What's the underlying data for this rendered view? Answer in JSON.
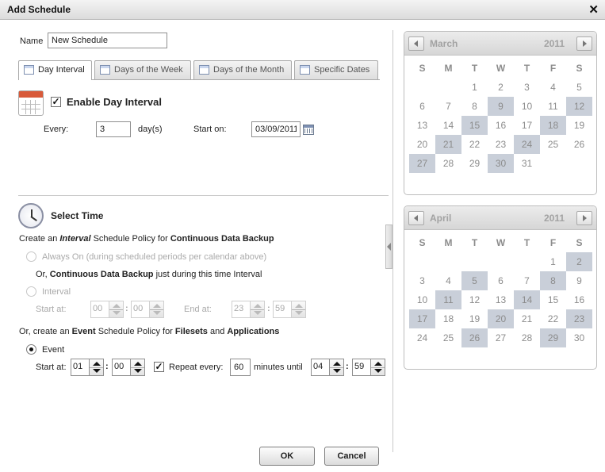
{
  "window": {
    "title": "Add Schedule",
    "close_icon": "✕"
  },
  "name_field": {
    "label": "Name",
    "value": "New Schedule"
  },
  "tabs": [
    {
      "label": "Day Interval",
      "active": true
    },
    {
      "label": "Days of the Week",
      "active": false
    },
    {
      "label": "Days of the Month",
      "active": false
    },
    {
      "label": "Specific Dates",
      "active": false
    }
  ],
  "day_interval": {
    "enable_label": "Enable Day Interval",
    "enabled": true,
    "every_label": "Every:",
    "every_value": "3",
    "unit_label": "day(s)",
    "start_on_label": "Start on:",
    "start_on_value": "03/09/2011"
  },
  "select_time": {
    "heading": "Select Time",
    "interval_policy": {
      "prefix": "Create an",
      "keyword": "Interval",
      "middle": "Schedule Policy for",
      "target": "Continuous Data Backup"
    },
    "always_on_label": "Always On (during scheduled periods per calendar above)",
    "or_cdb": {
      "prefix": "Or,",
      "target": "Continuous Data Backup",
      "suffix": "just during this time Interval"
    },
    "interval_label": "Interval",
    "start_at_label": "Start at:",
    "end_at_label": "End at:",
    "interval_start": {
      "hour": "00",
      "minute": "00"
    },
    "interval_end": {
      "hour": "23",
      "minute": "59"
    },
    "event_policy": {
      "prefix": "Or, create an",
      "keyword": "Event",
      "middle": "Schedule Policy for",
      "target1": "Filesets",
      "and": "and",
      "target2": "Applications"
    },
    "event_label": "Event",
    "event_start_label": "Start at:",
    "event_start": {
      "hour": "01",
      "minute": "00"
    },
    "repeat_label": "Repeat every:",
    "repeat_checked": true,
    "repeat_value": "60",
    "until_label": "minutes until",
    "event_until": {
      "hour": "04",
      "minute": "59"
    }
  },
  "buttons": {
    "ok": "OK",
    "cancel": "Cancel"
  },
  "calendars": [
    {
      "month": "March",
      "year": "2011",
      "weekdays": [
        "S",
        "M",
        "T",
        "W",
        "T",
        "F",
        "S"
      ],
      "weeks": [
        [
          "",
          "",
          "1",
          "2",
          "3",
          "4",
          "5"
        ],
        [
          "6",
          "7",
          "8",
          "9",
          "10",
          "11",
          "12"
        ],
        [
          "13",
          "14",
          "15",
          "16",
          "17",
          "18",
          "19"
        ],
        [
          "20",
          "21",
          "22",
          "23",
          "24",
          "25",
          "26"
        ],
        [
          "27",
          "28",
          "29",
          "30",
          "31",
          "",
          ""
        ]
      ],
      "highlighted": [
        "9",
        "12",
        "15",
        "18",
        "21",
        "24",
        "27",
        "30"
      ]
    },
    {
      "month": "April",
      "year": "2011",
      "weekdays": [
        "S",
        "M",
        "T",
        "W",
        "T",
        "F",
        "S"
      ],
      "weeks": [
        [
          "",
          "",
          "",
          "",
          "",
          "1",
          "2"
        ],
        [
          "3",
          "4",
          "5",
          "6",
          "7",
          "8",
          "9"
        ],
        [
          "10",
          "11",
          "12",
          "13",
          "14",
          "15",
          "16"
        ],
        [
          "17",
          "18",
          "19",
          "20",
          "21",
          "22",
          "23"
        ],
        [
          "24",
          "25",
          "26",
          "27",
          "28",
          "29",
          "30"
        ]
      ],
      "highlighted": [
        "2",
        "5",
        "8",
        "11",
        "14",
        "17",
        "20",
        "23",
        "26",
        "29"
      ]
    }
  ]
}
